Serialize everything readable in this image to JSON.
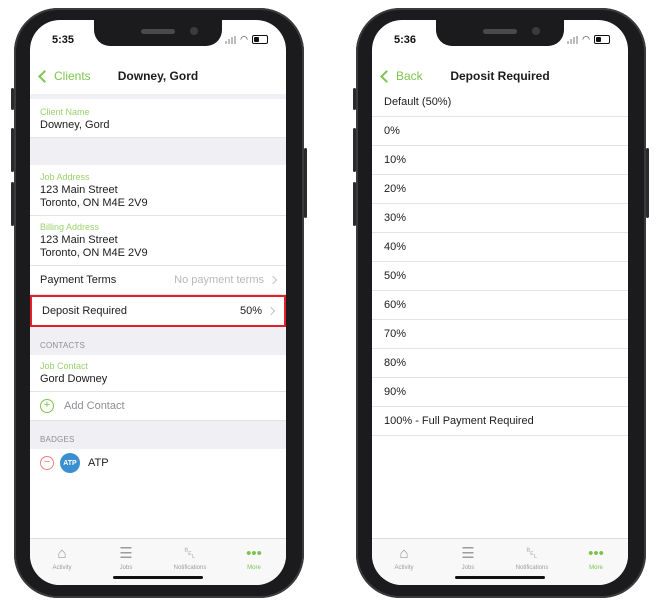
{
  "left": {
    "status": {
      "time": "5:35"
    },
    "nav": {
      "back_label": "Clients",
      "title": "Downey, Gord"
    },
    "client_name": {
      "label": "Client Name",
      "value": "Downey, Gord"
    },
    "job_address": {
      "label": "Job Address",
      "line1": "123 Main Street",
      "line2": "Toronto, ON M4E 2V9"
    },
    "billing_address": {
      "label": "Billing Address",
      "line1": "123 Main Street",
      "line2": "Toronto, ON M4E 2V9"
    },
    "payment_terms": {
      "label": "Payment Terms",
      "value": "No payment terms"
    },
    "deposit_required": {
      "label": "Deposit Required",
      "value": "50%"
    },
    "contacts": {
      "header": "CONTACTS",
      "job_contact_label": "Job Contact",
      "job_contact_value": "Gord Downey",
      "add_label": "Add Contact"
    },
    "badges": {
      "header": "BADGES",
      "item_icon_text": "ATP",
      "item_label": "ATP"
    }
  },
  "right": {
    "status": {
      "time": "5:36"
    },
    "nav": {
      "back_label": "Back",
      "title": "Deposit Required"
    },
    "options": [
      "Default (50%)",
      "0%",
      "10%",
      "20%",
      "30%",
      "40%",
      "50%",
      "60%",
      "70%",
      "80%",
      "90%",
      "100% - Full Payment Required"
    ]
  },
  "tabbar": [
    {
      "label": "Activity",
      "icon": "house-icon"
    },
    {
      "label": "Jobs",
      "icon": "list-icon"
    },
    {
      "label": "Notifications",
      "icon": "bell-icon"
    },
    {
      "label": "More",
      "icon": "ellipsis-icon"
    }
  ],
  "colors": {
    "accent": "#7cc44c",
    "highlight": "#e3202a",
    "group_bg": "#efeff4"
  }
}
